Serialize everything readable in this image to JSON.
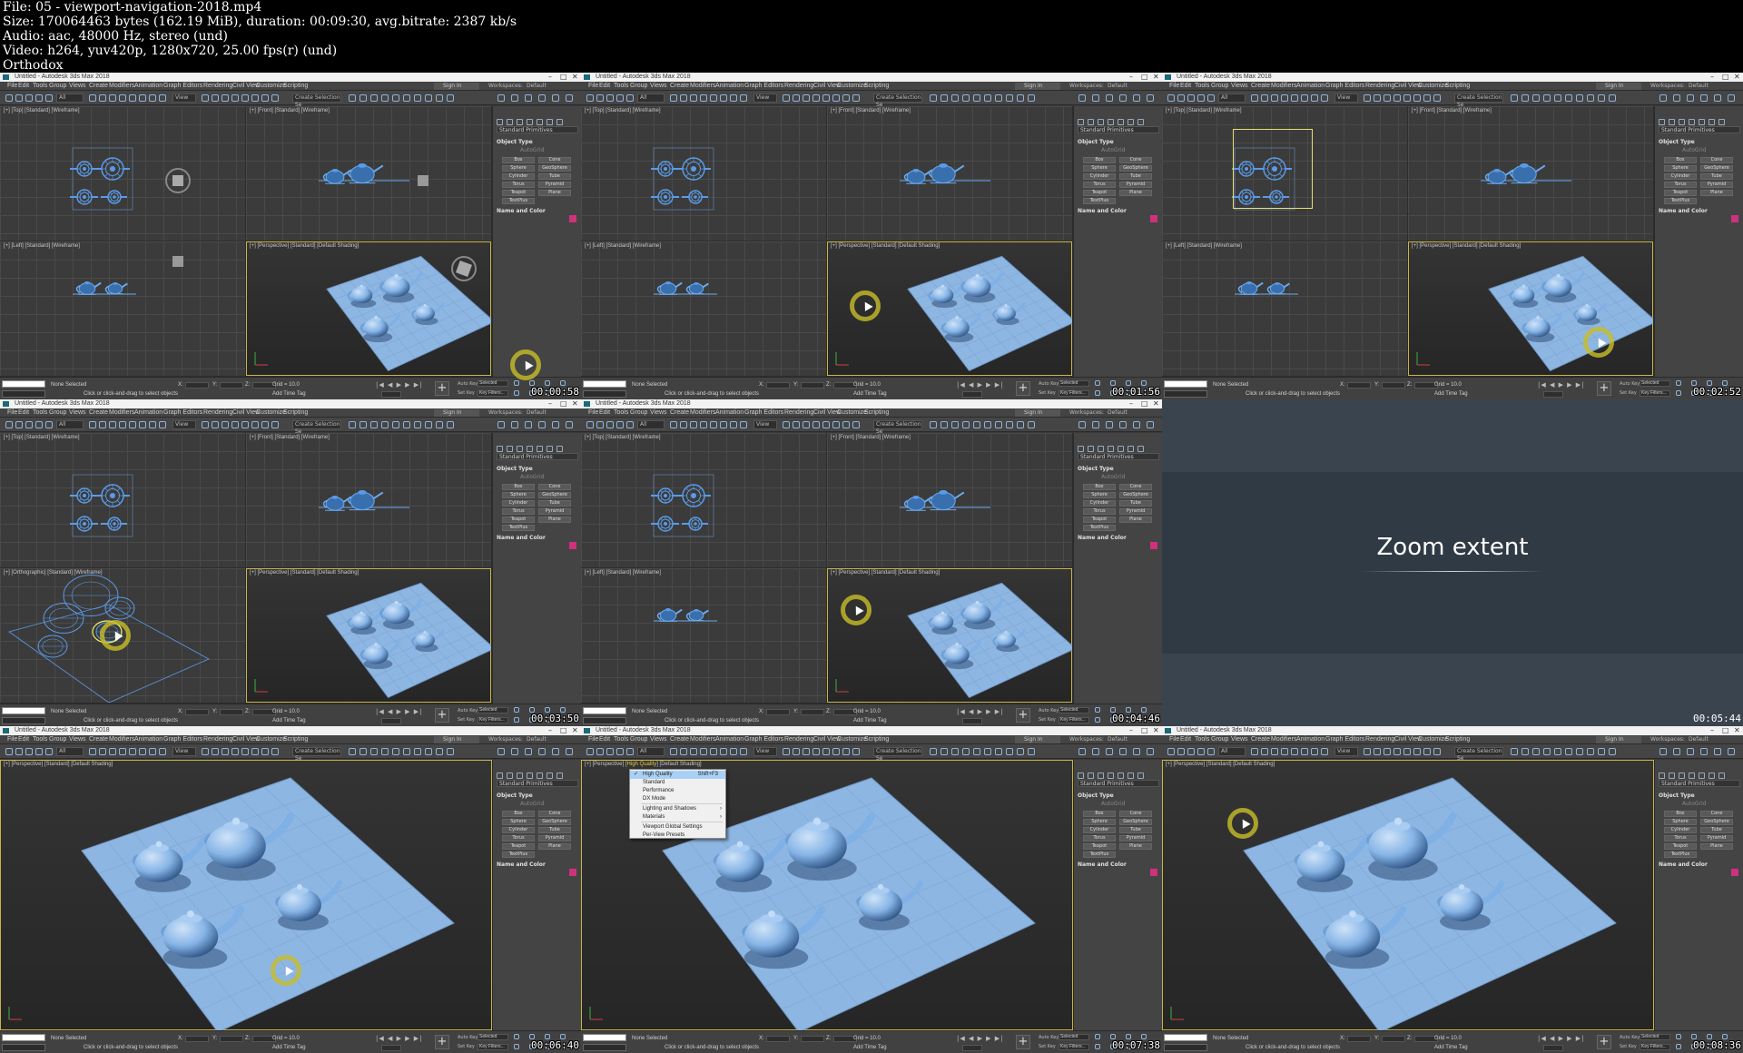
{
  "header": {
    "lines": [
      "File: 05 - viewport-navigation-2018.mp4",
      "Size: 170064463 bytes (162.19 MiB), duration: 00:09:30, avg.bitrate: 2387 kb/s",
      "Audio: aac, 48000 Hz, stereo (und)",
      "Video: h264, yuv420p, 1280x720, 25.00 fps(r) (und)",
      "Orthodox"
    ]
  },
  "app": {
    "window_title": "Untitled - Autodesk 3ds Max 2018",
    "menu": [
      "File",
      "Edit",
      "Tools",
      "Group",
      "Views",
      "Create",
      "Modifiers",
      "Animation",
      "Graph Editors",
      "Rendering",
      "Civil View",
      "Customize",
      "Scripting"
    ],
    "sign_in": "Sign In",
    "workspaces_label": "Workspaces:",
    "workspaces_value": "Default",
    "filter_all": "All",
    "view_dropdown": "View",
    "create_selection": "Create Selection Se",
    "viewport_labels": {
      "top": "[+] [Top] [Standard] [Wireframe]",
      "front": "[+] [Front] [Standard] [Wireframe]",
      "left": "[+] [Left] [Standard] [Wireframe]",
      "perspective": "[+] [Perspective] [Standard] [Default Shading]",
      "orthographic": "[+] [Orthographic] [Standard] [Wireframe]",
      "persp_hq_prefix": "[+] [Perspective] [",
      "persp_hq_mid": "High Quality",
      "persp_hq_suffix": "] [Default Shading]"
    },
    "command_panel": {
      "category": "Standard Primitives",
      "object_type": "Object Type",
      "autogrid": "AutoGrid",
      "buttons": [
        "Box",
        "Cone",
        "Sphere",
        "GeoSphere",
        "Cylinder",
        "Tube",
        "Torus",
        "Pyramid",
        "Teapot",
        "Plane",
        "TextPlus"
      ],
      "name_and_color": "Name and Color"
    },
    "status": {
      "none_selected": "None Selected",
      "prompt": "Click or click-and-drag to select objects",
      "x": "X:",
      "y": "Y:",
      "z": "Z:",
      "grid": "Grid = 10.0",
      "add_time_tag": "Add Time Tag",
      "auto_key": "Auto Key",
      "selected": "Selected",
      "set_key": "Set Key",
      "key_filters": "Key Filters...",
      "maxscript": "MAXScript Mi",
      "frame": "0"
    },
    "context_menu": {
      "items": [
        {
          "label": "High Quality",
          "shortcut": "Shift+F3",
          "checked": true,
          "highlight": true
        },
        {
          "label": "Standard"
        },
        {
          "label": "Performance"
        },
        {
          "label": "DX Mode"
        },
        {
          "label": "Lighting and Shadows",
          "submenu": true
        },
        {
          "label": "Materials",
          "submenu": true
        },
        {
          "label": "Viewport Global Settings"
        },
        {
          "label": "Per-View Presets"
        }
      ]
    }
  },
  "thumbnails": [
    {
      "timecode": "00:00:58"
    },
    {
      "timecode": "00:01:56"
    },
    {
      "timecode": "00:02:52"
    },
    {
      "timecode": "00:03:50"
    },
    {
      "timecode": "00:04:46"
    },
    {
      "timecode": "00:05:44"
    },
    {
      "timecode": "00:06:40"
    },
    {
      "timecode": "00:07:38"
    },
    {
      "timecode": "00:08:36"
    }
  ],
  "slide": {
    "title": "Zoom extent"
  },
  "colors": {
    "wireframe": "#5a9be8",
    "shaded_teapot": "#7fb0e6",
    "plane": "#90b8e4",
    "highlight_ring": "#c8be28",
    "active_viewport": "#c8b448"
  }
}
